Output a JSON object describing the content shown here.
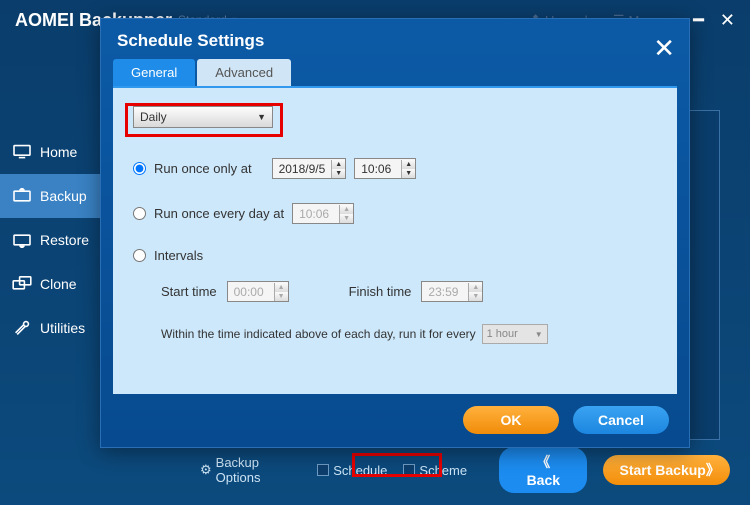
{
  "app": {
    "title": "AOMEI Backupper",
    "edition": "Standard"
  },
  "titlebar": {
    "upgrade": "Upgrade",
    "menu": "Menu"
  },
  "sidebar": {
    "items": [
      {
        "label": "Home"
      },
      {
        "label": "Backup"
      },
      {
        "label": "Restore"
      },
      {
        "label": "Clone"
      },
      {
        "label": "Utilities"
      }
    ]
  },
  "bottom": {
    "backup_options": "Backup Options",
    "schedule": "Schedule",
    "scheme": "Scheme",
    "back": "《 Back",
    "start": "Start Backup》"
  },
  "modal": {
    "title": "Schedule Settings",
    "tabs": {
      "general": "General",
      "advanced": "Advanced"
    },
    "frequency": "Daily",
    "opt1": {
      "label": "Run once only at",
      "date": "2018/9/5",
      "time": "10:06"
    },
    "opt2": {
      "label": "Run once every day at",
      "time": "10:06"
    },
    "opt3": {
      "label": "Intervals",
      "start_label": "Start time",
      "start_value": "00:00",
      "finish_label": "Finish time",
      "finish_value": "23:59",
      "note": "Within the time indicated above of each day, run it for every",
      "every": "1 hour"
    },
    "ok": "OK",
    "cancel": "Cancel"
  }
}
